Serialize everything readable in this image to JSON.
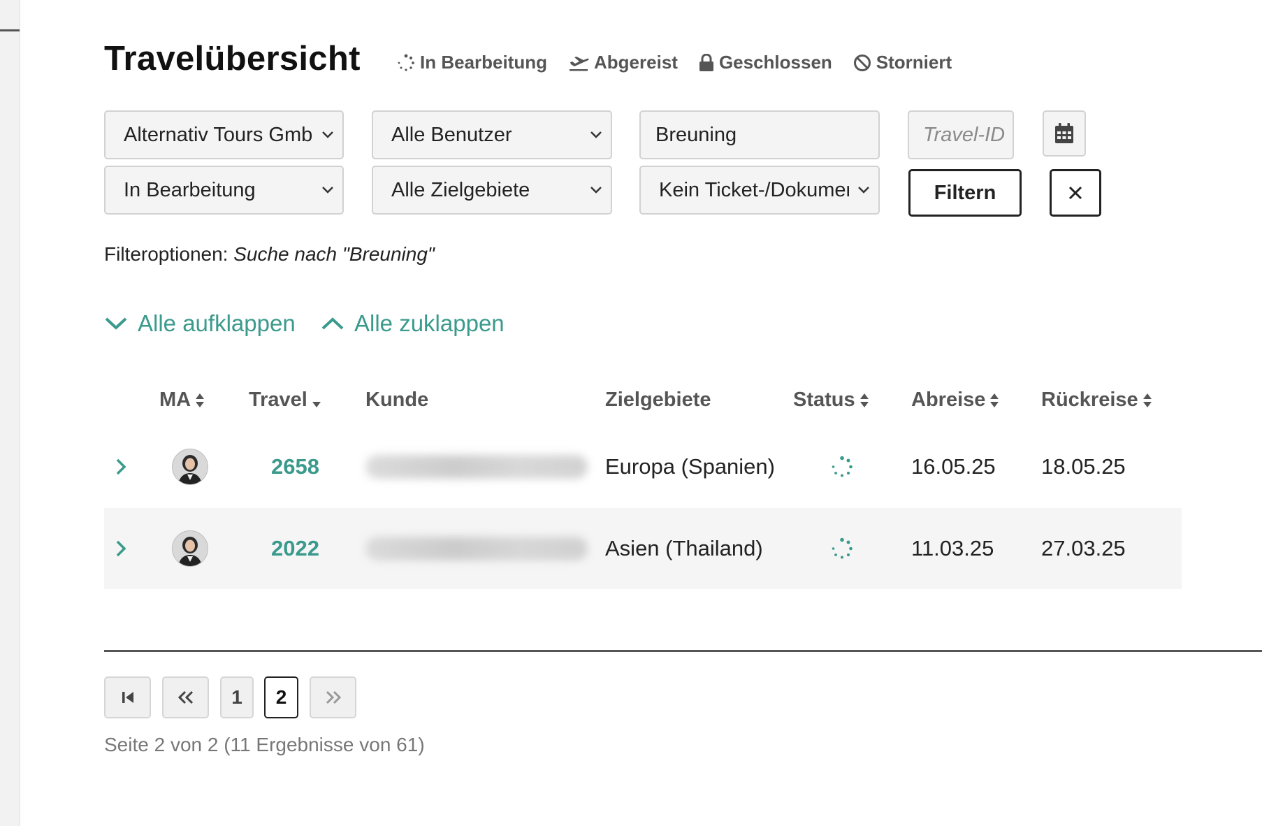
{
  "header": {
    "title": "Travelübersicht",
    "legend": [
      {
        "icon": "spinner-icon",
        "label": "In Bearbeitung"
      },
      {
        "icon": "plane-departure-icon",
        "label": "Abgereist"
      },
      {
        "icon": "lock-icon",
        "label": "Geschlossen"
      },
      {
        "icon": "ban-icon",
        "label": "Storniert"
      }
    ]
  },
  "filters": {
    "company": "Alternativ Tours GmbH",
    "users": "Alle Benutzer",
    "search": "Breuning",
    "travel_id_placeholder": "Travel-ID",
    "status": "In Bearbeitung",
    "regions": "Alle Zielgebiete",
    "tickets": "Kein Ticket-/Dokument",
    "filter_button": "Filtern",
    "clear_button": "×"
  },
  "filter_options": {
    "label": "Filteroptionen:",
    "query": "Suche nach \"Breuning\""
  },
  "expand": {
    "expand_all": "Alle aufklappen",
    "collapse_all": "Alle zuklappen"
  },
  "table": {
    "columns": {
      "ma": "MA",
      "travel": "Travel",
      "kunde": "Kunde",
      "zielgebiete": "Zielgebiete",
      "status": "Status",
      "abreise": "Abreise",
      "rueckreise": "Rückreise"
    },
    "rows": [
      {
        "travel": "2658",
        "region": "Europa (Spanien)",
        "status": "spinner-icon",
        "departure": "16.05.25",
        "return": "18.05.25"
      },
      {
        "travel": "2022",
        "region": "Asien (Thailand)",
        "status": "spinner-icon",
        "departure": "11.03.25",
        "return": "27.03.25"
      }
    ]
  },
  "pagination": {
    "pages": [
      "1",
      "2"
    ],
    "current": "2",
    "info": "Seite 2 von 2 (11 Ergebnisse von 61)"
  },
  "colors": {
    "accent": "#3a9a8c",
    "text": "#222222",
    "muted": "#555555"
  }
}
